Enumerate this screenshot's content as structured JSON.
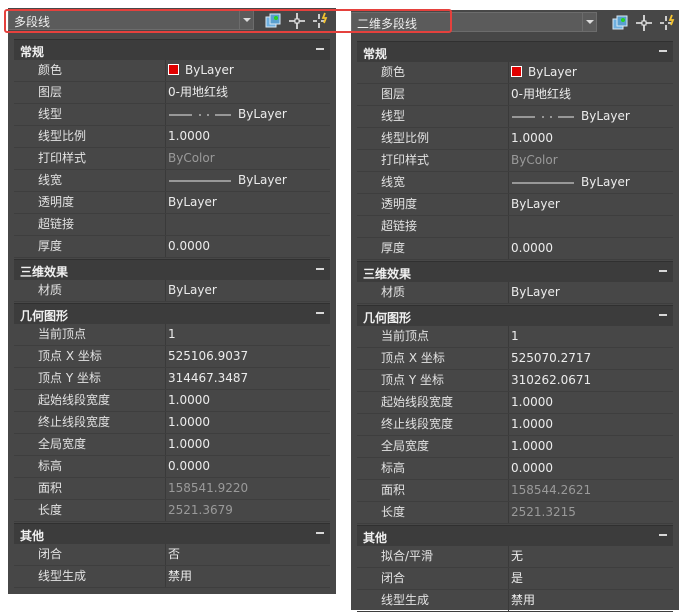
{
  "left": {
    "selector": "多段线",
    "sections": [
      {
        "title": "常规",
        "rows": [
          {
            "label": "颜色",
            "value": "ByLayer",
            "swatch": true
          },
          {
            "label": "图层",
            "value": "0-用地红线"
          },
          {
            "label": "线型",
            "value": "ByLayer",
            "line": "dashdot"
          },
          {
            "label": "线型比例",
            "value": "1.0000"
          },
          {
            "label": "打印样式",
            "value": "ByColor",
            "dim": true
          },
          {
            "label": "线宽",
            "value": "ByLayer",
            "line": "solid"
          },
          {
            "label": "透明度",
            "value": "ByLayer"
          },
          {
            "label": "超链接",
            "value": ""
          },
          {
            "label": "厚度",
            "value": "0.0000"
          }
        ]
      },
      {
        "title": "三维效果",
        "rows": [
          {
            "label": "材质",
            "value": "ByLayer"
          }
        ]
      },
      {
        "title": "几何图形",
        "rows": [
          {
            "label": "当前顶点",
            "value": "1"
          },
          {
            "label": "顶点 X 坐标",
            "value": "525106.9037"
          },
          {
            "label": "顶点 Y 坐标",
            "value": "314467.3487"
          },
          {
            "label": "起始线段宽度",
            "value": "1.0000"
          },
          {
            "label": "终止线段宽度",
            "value": "1.0000"
          },
          {
            "label": "全局宽度",
            "value": "1.0000"
          },
          {
            "label": "标高",
            "value": "0.0000"
          },
          {
            "label": "面积",
            "value": "158541.9220",
            "dim": true
          },
          {
            "label": "长度",
            "value": "2521.3679",
            "dim": true
          }
        ]
      },
      {
        "title": "其他",
        "rows": [
          {
            "label": "闭合",
            "value": "否"
          },
          {
            "label": "线型生成",
            "value": "禁用"
          }
        ]
      }
    ]
  },
  "right": {
    "selector": "二维多段线",
    "sections": [
      {
        "title": "常规",
        "rows": [
          {
            "label": "颜色",
            "value": "ByLayer",
            "swatch": true
          },
          {
            "label": "图层",
            "value": "0-用地红线"
          },
          {
            "label": "线型",
            "value": "ByLayer",
            "line": "dashdot"
          },
          {
            "label": "线型比例",
            "value": "1.0000"
          },
          {
            "label": "打印样式",
            "value": "ByColor",
            "dim": true
          },
          {
            "label": "线宽",
            "value": "ByLayer",
            "line": "solid"
          },
          {
            "label": "透明度",
            "value": "ByLayer"
          },
          {
            "label": "超链接",
            "value": ""
          },
          {
            "label": "厚度",
            "value": "0.0000"
          }
        ]
      },
      {
        "title": "三维效果",
        "rows": [
          {
            "label": "材质",
            "value": "ByLayer"
          }
        ]
      },
      {
        "title": "几何图形",
        "rows": [
          {
            "label": "当前顶点",
            "value": "1"
          },
          {
            "label": "顶点 X 坐标",
            "value": "525070.2717"
          },
          {
            "label": "顶点 Y 坐标",
            "value": "310262.0671"
          },
          {
            "label": "起始线段宽度",
            "value": "1.0000"
          },
          {
            "label": "终止线段宽度",
            "value": "1.0000"
          },
          {
            "label": "全局宽度",
            "value": "1.0000"
          },
          {
            "label": "标高",
            "value": "0.0000"
          },
          {
            "label": "面积",
            "value": "158544.2621",
            "dim": true
          },
          {
            "label": "长度",
            "value": "2521.3215",
            "dim": true
          }
        ]
      },
      {
        "title": "其他",
        "rows": [
          {
            "label": "拟合/平滑",
            "value": "无"
          },
          {
            "label": "闭合",
            "value": "是"
          },
          {
            "label": "线型生成",
            "value": "禁用"
          }
        ]
      }
    ]
  },
  "icons": [
    "quick-select-icon",
    "select-objects-icon",
    "toggle-pickadd-icon"
  ],
  "colors": {
    "highlight": "#e5413d",
    "swatch": "#e00000",
    "panel": "#474747",
    "section": "#3c3c3c"
  }
}
